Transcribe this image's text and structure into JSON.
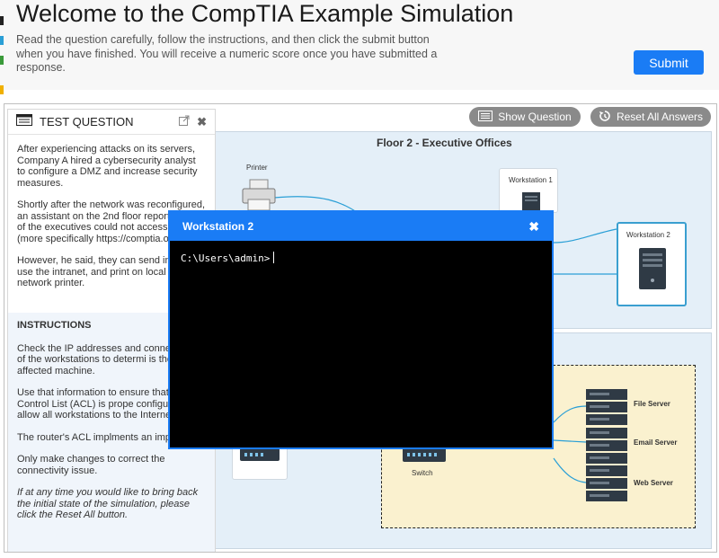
{
  "header": {
    "title": "Welcome to the CompTIA Example Simulation",
    "intro": "Read the question carefully, follow the instructions, and then click the submit button when you have finished. You will receive a numeric score once you have submitted a response.",
    "submit_label": "Submit"
  },
  "toolbar": {
    "show_question_label": "Show Question",
    "reset_label": "Reset All Answers"
  },
  "question_panel": {
    "title": "TEST QUESTION",
    "paragraphs": [
      "After experiencing attacks on its servers, Company A hired a cybersecurity analyst to configure a DMZ and increase security measures.",
      "Shortly after the network was reconfigured, an assistant on the 2nd floor reported one of the executives could not access Internet (more specifically https://comptia.org).",
      "However, he said, they can send in Email, use the intranet, and print on local area network printer."
    ],
    "instructions_title": "INSTRUCTIONS",
    "instructions": [
      "Check the IP addresses and conne each of the workstations to determi is the affected machine.",
      "Use that information to ensure that Access Control List (ACL) is prope configured to allow all workstations to the Internet.",
      "The router's ACL implments an impli deny.",
      "Only make changes to correct the connectivity issue."
    ],
    "reset_hint": "If at any time you would like to bring back the initial state of the simulation, please click the Reset All button."
  },
  "network": {
    "floor_title": "Floor 2 - Executive Offices",
    "printer_label": "Printer",
    "workstation1_label": "Workstation 1",
    "workstation2_label": "Workstation 2",
    "switch_label": "Switch",
    "file_server_label": "File Server",
    "email_server_label": "Email Server",
    "web_server_label": "Web Server"
  },
  "modal": {
    "title": "Workstation 2",
    "close_glyph": "✖",
    "prompt": "C:\\Users\\admin>"
  },
  "colors": {
    "accent": "#1a7cf5",
    "pill": "#8a8a8a",
    "floor_bg": "#e4eff8",
    "dmz_bg": "#faf1cf",
    "link": "#2a9fd6"
  }
}
